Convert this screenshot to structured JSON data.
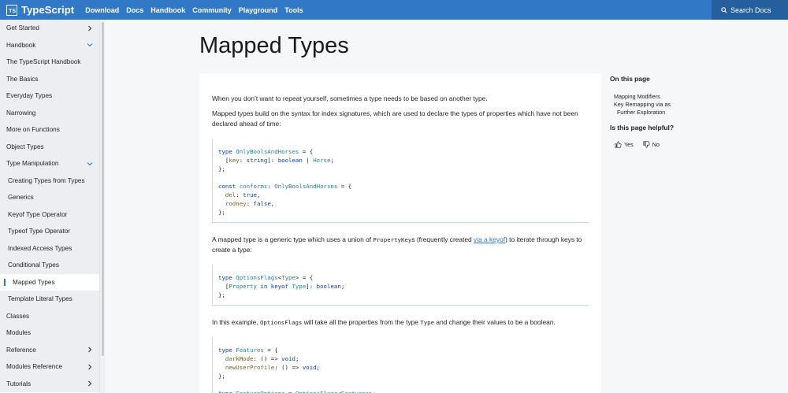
{
  "nav": {
    "logo_box": "TS",
    "brand": "TypeScript",
    "links": [
      "Download",
      "Docs",
      "Handbook",
      "Community",
      "Playground",
      "Tools"
    ],
    "search_label": "Search Docs"
  },
  "sidebar": {
    "items": [
      {
        "label": "Get Started",
        "kind": "section",
        "chevron": "right"
      },
      {
        "label": "Handbook",
        "kind": "section",
        "chevron": "down"
      },
      {
        "label": "The TypeScript Handbook",
        "kind": "item"
      },
      {
        "label": "The Basics",
        "kind": "item"
      },
      {
        "label": "Everyday Types",
        "kind": "item"
      },
      {
        "label": "Narrowing",
        "kind": "item"
      },
      {
        "label": "More on Functions",
        "kind": "item"
      },
      {
        "label": "Object Types",
        "kind": "item"
      },
      {
        "label": "Type Manipulation",
        "kind": "sub",
        "chevron": "down"
      },
      {
        "label": "Creating Types from Types",
        "kind": "child"
      },
      {
        "label": "Generics",
        "kind": "child"
      },
      {
        "label": "Keyof Type Operator",
        "kind": "child"
      },
      {
        "label": "Typeof Type Operator",
        "kind": "child"
      },
      {
        "label": "Indexed Access Types",
        "kind": "child"
      },
      {
        "label": "Conditional Types",
        "kind": "child"
      },
      {
        "label": "Mapped Types",
        "kind": "active"
      },
      {
        "label": "Template Literal Types",
        "kind": "child"
      },
      {
        "label": "Classes",
        "kind": "item"
      },
      {
        "label": "Modules",
        "kind": "item"
      },
      {
        "label": "Reference",
        "kind": "section",
        "chevron": "right"
      },
      {
        "label": "Modules Reference",
        "kind": "section",
        "chevron": "right"
      },
      {
        "label": "Tutorials",
        "kind": "section",
        "chevron": "right"
      }
    ]
  },
  "page": {
    "title": "Mapped Types",
    "p1": "When you don’t want to repeat yourself, sometimes a type needs to be based on another type.",
    "p2": "Mapped types build on the syntax for index signatures, which are used to declare the types of properties which have not been declared ahead of time:",
    "p3_before": "A mapped type is a generic type which uses a union of ",
    "p3_code": "PropertyKey",
    "p3_mid": "s (frequently created ",
    "p3_link": "via a keyof",
    "p3_after": ") to iterate through keys to create a type:",
    "p4_before": "In this example, ",
    "p4_code1": "OptionsFlags",
    "p4_mid": " will take all the properties from the type ",
    "p4_code2": "Type",
    "p4_after": " and change their values to be a boolean."
  },
  "toc": {
    "heading": "On this page",
    "links": [
      "Mapping Modifiers",
      "Key Remapping via as",
      "Further Exploration"
    ],
    "helpful_heading": "Is this page helpful?",
    "yes": "Yes",
    "no": "No"
  }
}
